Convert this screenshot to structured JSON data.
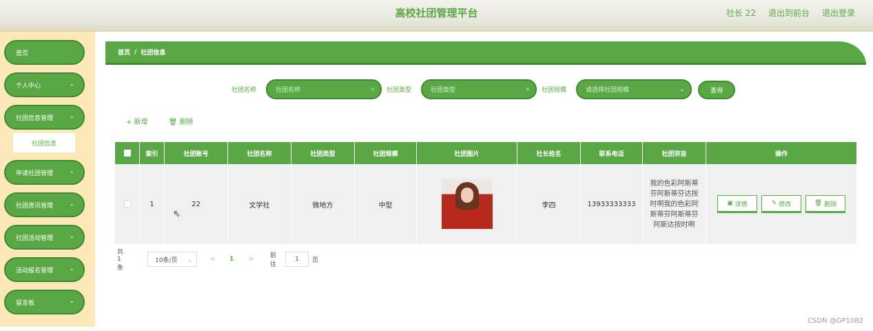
{
  "header": {
    "title": "高校社团管理平台",
    "user_label": "社长 22",
    "back_label": "退出到前台",
    "logout_label": "退出登录"
  },
  "sidebar": {
    "items": [
      {
        "label": "首页",
        "has_children": false
      },
      {
        "label": "个人中心",
        "has_children": true
      },
      {
        "label": "社团信息管理",
        "has_children": true
      },
      {
        "label": "申请社团管理",
        "has_children": true
      },
      {
        "label": "社团资讯管理",
        "has_children": true
      },
      {
        "label": "社团活动管理",
        "has_children": true
      },
      {
        "label": "活动报名管理",
        "has_children": true
      },
      {
        "label": "留言板",
        "has_children": true
      }
    ],
    "active_submenu": "社团信息"
  },
  "breadcrumb": {
    "home": "首页",
    "separator": "/",
    "current": "社团信息"
  },
  "search": {
    "name_label": "社团名称",
    "name_placeholder": "社团名称",
    "type_label": "社团类型",
    "type_placeholder": "社团类型",
    "scale_label": "社团规模",
    "scale_placeholder": "请选择社团规模",
    "query_label": "查询"
  },
  "actions": {
    "add_label": "+ 新增",
    "delete_label": "🗑 删除"
  },
  "table": {
    "headers": [
      "索引",
      "社团账号",
      "社团名称",
      "社团类型",
      "社团规模",
      "社团图片",
      "社长姓名",
      "联系电话",
      "社团宗旨",
      "操作"
    ],
    "rows": [
      {
        "index": "1",
        "account": "22",
        "name": "文学社",
        "type": "微地方",
        "scale": "中型",
        "leader": "李四",
        "phone": "13933333333",
        "aim": "我的色彩阿斯蒂芬阿斯蒂芬达按时啊我的色彩阿斯蒂芬阿斯蒂芬阿斯达按时啊",
        "detail_label": "详情",
        "edit_label": "修改",
        "delete_label": "删除"
      }
    ]
  },
  "pagination": {
    "total": "共 1 条",
    "page_size": "10条/页",
    "prev": "<",
    "current_page": "1",
    "next": ">",
    "goto_label": "前往",
    "goto_value": "1",
    "page_suffix": "页"
  },
  "watermark": "CSDN @GP1082",
  "colors": {
    "primary": "#5aa845",
    "primary_dark": "#3f8a2e",
    "sidebar_bg": "#fde8ba"
  }
}
